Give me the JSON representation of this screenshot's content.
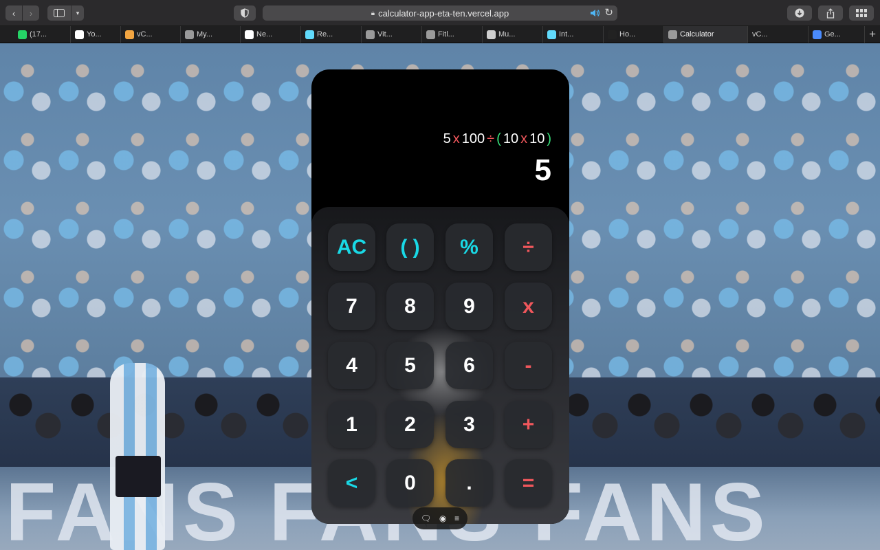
{
  "browser": {
    "url": "calculator-app-eta-ten.vercel.app",
    "tabs": [
      {
        "label": "(17...",
        "icon": "whatsapp-icon",
        "color": "#25d366"
      },
      {
        "label": "Yo...",
        "icon": "github-icon",
        "color": "#ffffff"
      },
      {
        "label": "vC...",
        "icon": "vc-icon",
        "color": "#f2a541"
      },
      {
        "label": "My...",
        "icon": "c-icon",
        "color": "#9a9a9a"
      },
      {
        "label": "Ne...",
        "icon": "triangle-icon",
        "color": "#ffffff"
      },
      {
        "label": "Re...",
        "icon": "react-icon",
        "color": "#61dafb"
      },
      {
        "label": "Vit...",
        "icon": "l-icon",
        "color": "#9a9a9a"
      },
      {
        "label": "Fitl...",
        "icon": "f-icon",
        "color": "#9a9a9a"
      },
      {
        "label": "Mu...",
        "icon": "w-icon",
        "color": "#cfcfcf"
      },
      {
        "label": "Int...",
        "icon": "react-icon",
        "color": "#61dafb"
      },
      {
        "label": "Ho...",
        "icon": "image-icon",
        "color": "#222222"
      },
      {
        "label": "Calculator",
        "icon": "c-icon",
        "color": "#9a9a9a"
      },
      {
        "label": "vC...",
        "icon": "",
        "color": ""
      },
      {
        "label": "Ge...",
        "icon": "sparkle-icon",
        "color": "#4a8cff"
      }
    ]
  },
  "calculator": {
    "expression": [
      {
        "t": "5",
        "k": "num"
      },
      {
        "t": "x",
        "k": "mul"
      },
      {
        "t": "100",
        "k": "num"
      },
      {
        "t": "÷",
        "k": "div"
      },
      {
        "t": "(",
        "k": "paren"
      },
      {
        "t": "10",
        "k": "num"
      },
      {
        "t": "x",
        "k": "mul"
      },
      {
        "t": "10",
        "k": "num"
      },
      {
        "t": ")",
        "k": "paren"
      }
    ],
    "result": "5",
    "keys": [
      [
        "AC",
        "( )",
        "%",
        "÷"
      ],
      [
        "7",
        "8",
        "9",
        "x"
      ],
      [
        "4",
        "5",
        "6",
        "-"
      ],
      [
        "1",
        "2",
        "3",
        "+"
      ],
      [
        "<",
        "0",
        ".",
        "="
      ]
    ],
    "colors": {
      "accent": "#19d9e6",
      "operator": "#f0575c",
      "paren": "#38e07a"
    }
  },
  "background": {
    "banner_text": "FANS FANS FANS"
  }
}
